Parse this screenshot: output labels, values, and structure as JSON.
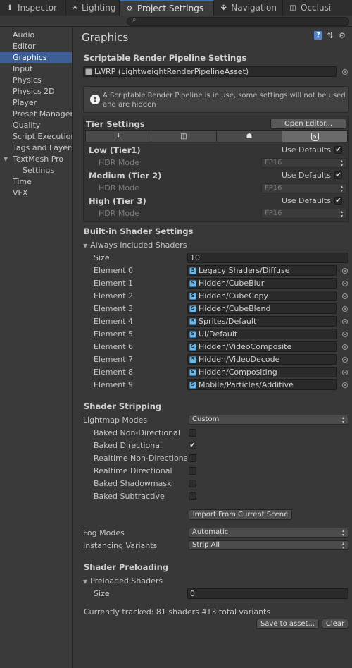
{
  "tabs": [
    {
      "label": "Inspector",
      "icon": "info-icon"
    },
    {
      "label": "Lighting",
      "icon": "lighting-icon"
    },
    {
      "label": "Project Settings",
      "icon": "gear-icon"
    },
    {
      "label": "Navigation",
      "icon": "navigation-icon"
    },
    {
      "label": "Occlusi",
      "icon": "occlusion-icon"
    }
  ],
  "sidebar": {
    "items": [
      {
        "label": "Audio"
      },
      {
        "label": "Editor"
      },
      {
        "label": "Graphics"
      },
      {
        "label": "Input"
      },
      {
        "label": "Physics"
      },
      {
        "label": "Physics 2D"
      },
      {
        "label": "Player"
      },
      {
        "label": "Preset Manager"
      },
      {
        "label": "Quality"
      },
      {
        "label": "Script Execution Order"
      },
      {
        "label": "Tags and Layers"
      },
      {
        "label": "TextMesh Pro"
      },
      {
        "label": "Settings"
      },
      {
        "label": "Time"
      },
      {
        "label": "VFX"
      }
    ],
    "selected": "Graphics"
  },
  "page": {
    "title": "Graphics"
  },
  "srp": {
    "heading": "Scriptable Render Pipeline Settings",
    "asset": "LWRP (LightweightRenderPipelineAsset)",
    "help": "A Scriptable Render Pipeline is in use, some settings will not be used and are hidden"
  },
  "tiers": {
    "heading": "Tier Settings",
    "open_editor": "Open Editor...",
    "platforms": [
      "download-icon",
      "switch-icon",
      "android-icon",
      "html5-icon"
    ],
    "html5_label": "5",
    "hdr_label": "HDR Mode",
    "use_defaults_label": "Use Defaults",
    "rows": [
      {
        "name": "Low (Tier1)",
        "hdr": "FP16",
        "use_defaults": true
      },
      {
        "name": "Medium (Tier 2)",
        "hdr": "FP16",
        "use_defaults": true
      },
      {
        "name": "High (Tier 3)",
        "hdr": "FP16",
        "use_defaults": true
      }
    ]
  },
  "builtin": {
    "heading": "Built-in Shader Settings",
    "foldout": "Always Included Shaders",
    "size_label": "Size",
    "size": "10",
    "elements": [
      {
        "label": "Element 0",
        "value": "Legacy Shaders/Diffuse"
      },
      {
        "label": "Element 1",
        "value": "Hidden/CubeBlur"
      },
      {
        "label": "Element 2",
        "value": "Hidden/CubeCopy"
      },
      {
        "label": "Element 3",
        "value": "Hidden/CubeBlend"
      },
      {
        "label": "Element 4",
        "value": "Sprites/Default"
      },
      {
        "label": "Element 5",
        "value": "UI/Default"
      },
      {
        "label": "Element 6",
        "value": "Hidden/VideoComposite"
      },
      {
        "label": "Element 7",
        "value": "Hidden/VideoDecode"
      },
      {
        "label": "Element 8",
        "value": "Hidden/Compositing"
      },
      {
        "label": "Element 9",
        "value": "Mobile/Particles/Additive"
      }
    ]
  },
  "stripping": {
    "heading": "Shader Stripping",
    "lightmap_label": "Lightmap Modes",
    "lightmap_value": "Custom",
    "options": [
      {
        "label": "Baked Non-Directional",
        "checked": false
      },
      {
        "label": "Baked Directional",
        "checked": true
      },
      {
        "label": "Realtime Non-Directional",
        "checked": false
      },
      {
        "label": "Realtime Directional",
        "checked": false
      },
      {
        "label": "Baked Shadowmask",
        "checked": false
      },
      {
        "label": "Baked Subtractive",
        "checked": false
      }
    ],
    "import_button": "Import From Current Scene",
    "fog_label": "Fog Modes",
    "fog_value": "Automatic",
    "instancing_label": "Instancing Variants",
    "instancing_value": "Strip All"
  },
  "preloading": {
    "heading": "Shader Preloading",
    "foldout": "Preloaded Shaders",
    "size_label": "Size",
    "size": "0",
    "tracked": "Currently tracked: 81 shaders 413 total variants",
    "save_button": "Save to asset...",
    "clear_button": "Clear"
  },
  "colors": {
    "selection": "#3e5f96",
    "accent_tab": "#3a72b0",
    "background": "#383838"
  }
}
